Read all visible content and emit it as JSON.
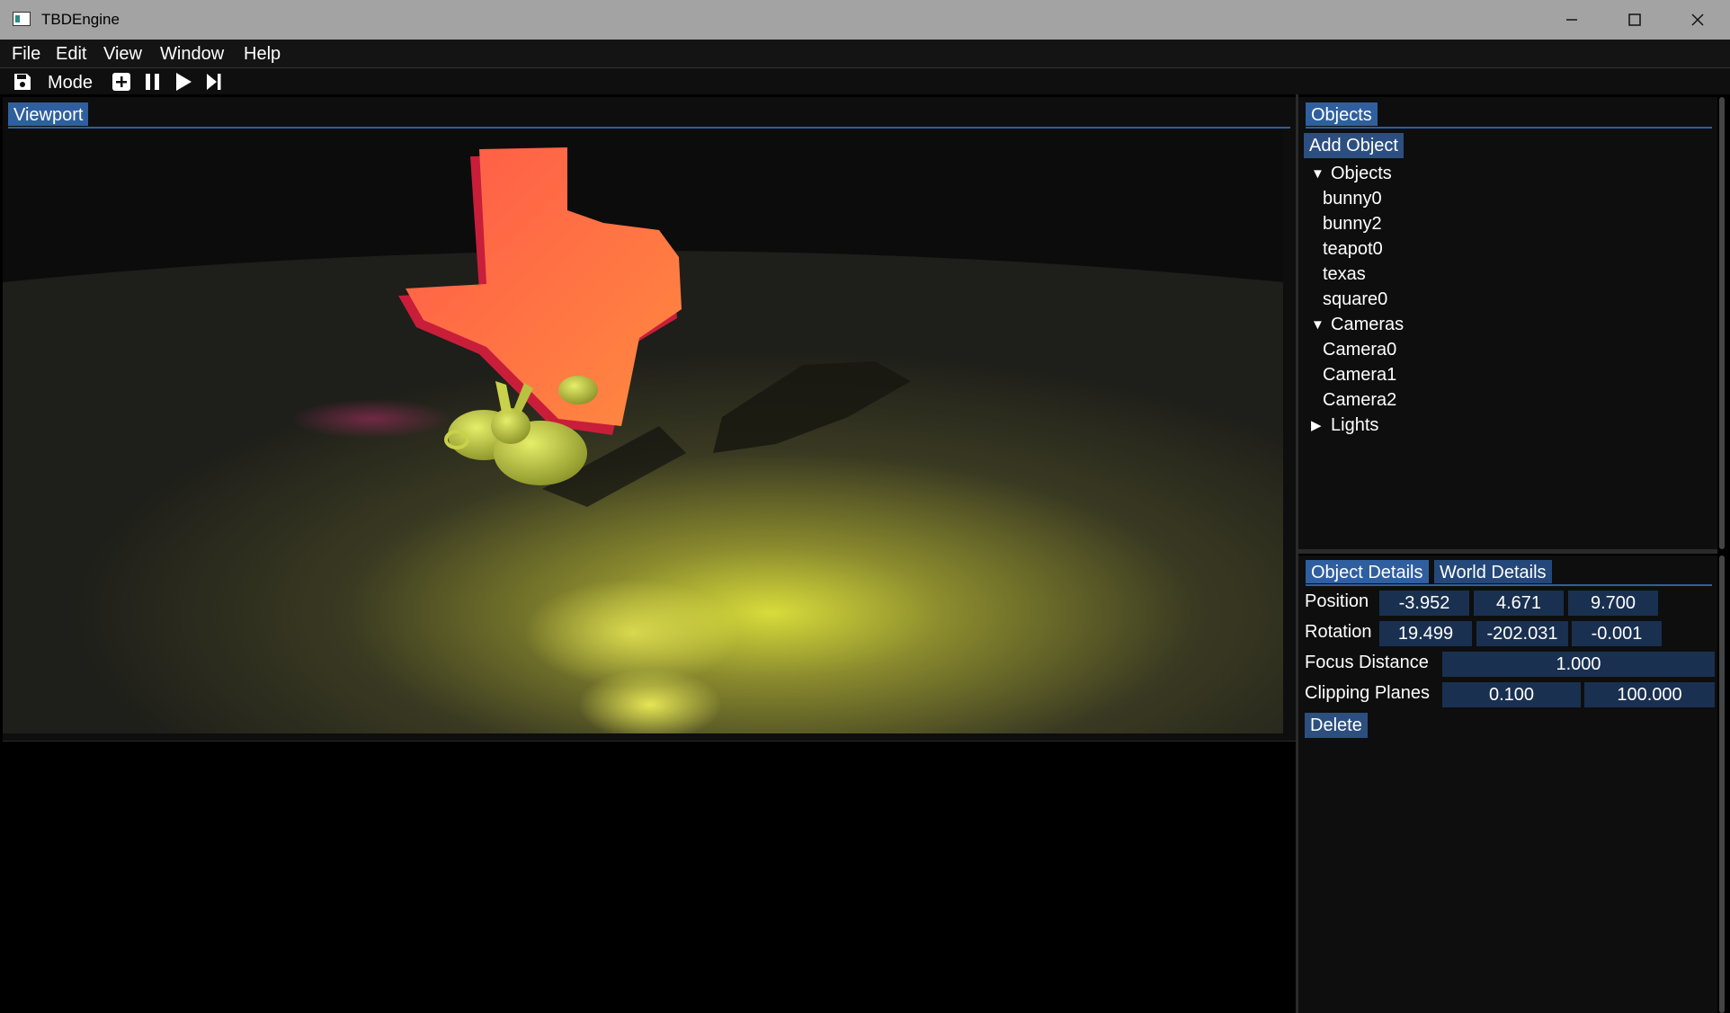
{
  "window": {
    "title": "TBDEngine"
  },
  "menu": [
    {
      "label": "File"
    },
    {
      "label": "Edit"
    },
    {
      "label": "View"
    },
    {
      "label": "Window"
    },
    {
      "label": "Help"
    }
  ],
  "toolbar": {
    "save_icon": "save-icon",
    "mode_label": "Mode",
    "add_icon": "add-icon",
    "pause_icon": "pause-icon",
    "play_icon": "play-icon",
    "step_icon": "step-icon"
  },
  "viewport": {
    "tab_label": "Viewport"
  },
  "objects_panel": {
    "tab_label": "Objects",
    "add_button": "Add Object",
    "groups": [
      {
        "label": "Objects",
        "expanded": true,
        "children": [
          "bunny0",
          "bunny2",
          "teapot0",
          "texas",
          "square0"
        ]
      },
      {
        "label": "Cameras",
        "expanded": true,
        "children": [
          "Camera0",
          "Camera1",
          "Camera2"
        ]
      },
      {
        "label": "Lights",
        "expanded": false,
        "children": []
      }
    ]
  },
  "details_panel": {
    "tabs": [
      {
        "label": "Object Details",
        "active": true
      },
      {
        "label": "World Details",
        "active": false
      }
    ],
    "position": {
      "label": "Position",
      "values": [
        "-3.952",
        "4.671",
        "9.700"
      ]
    },
    "rotation": {
      "label": "Rotation",
      "values": [
        "19.499",
        "-202.031",
        "-0.001"
      ]
    },
    "focus_distance": {
      "label": "Focus Distance",
      "value": "1.000"
    },
    "clipping_planes": {
      "label": "Clipping Planes",
      "values": [
        "0.100",
        "100.000"
      ]
    },
    "delete_button": "Delete"
  },
  "colors": {
    "accent": "#2f5f9f",
    "field_bg": "#1a3050",
    "panel_bg": "#0e0e0e",
    "texas_fill": "#ff6a45",
    "bunny_fill": "#c8d24a"
  }
}
